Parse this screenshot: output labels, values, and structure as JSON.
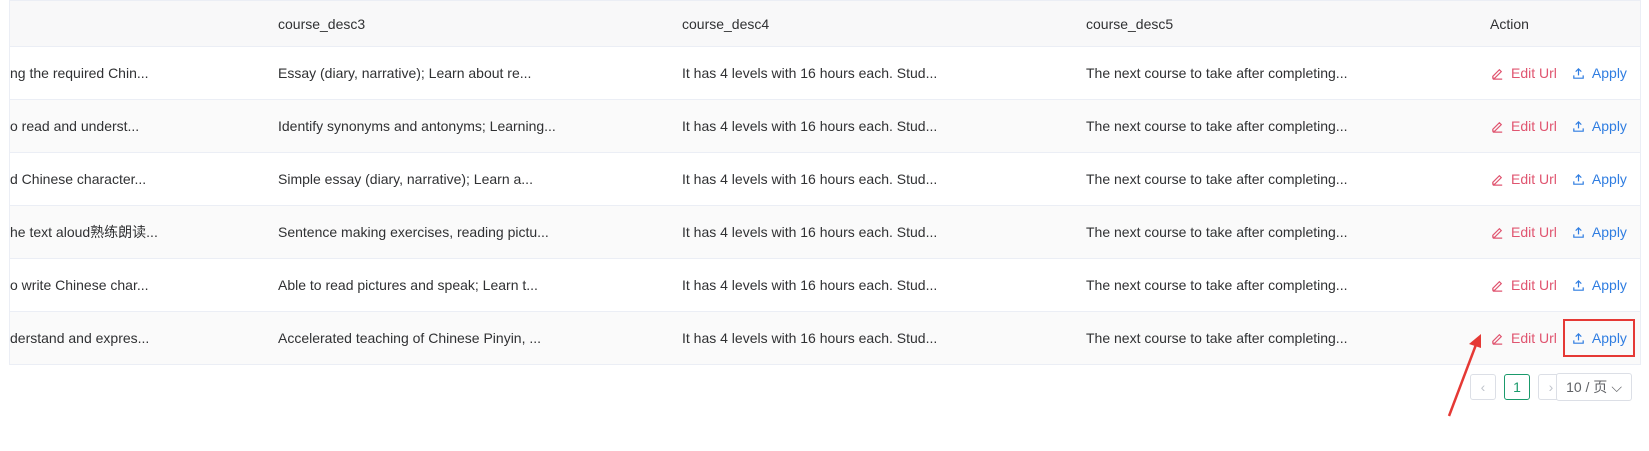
{
  "columns": {
    "desc3": "course_desc3",
    "desc4": "course_desc4",
    "desc5": "course_desc5",
    "action": "Action"
  },
  "rows": [
    {
      "c2": "ng the required Chin...",
      "c3": "Essay (diary, narrative); Learn about re...",
      "c4": "It has 4 levels with 16 hours each. Stud...",
      "c5": "The next course to take after completing..."
    },
    {
      "c2": "o read and underst...",
      "c3": "Identify synonyms and antonyms; Learning...",
      "c4": "It has 4 levels with 16 hours each. Stud...",
      "c5": "The next course to take after completing..."
    },
    {
      "c2": "d Chinese character...",
      "c3": "Simple essay (diary, narrative); Learn a...",
      "c4": "It has 4 levels with 16 hours each. Stud...",
      "c5": "The next course to take after completing..."
    },
    {
      "c2": "he text aloud熟练朗读...",
      "c3": "Sentence making exercises, reading pictu...",
      "c4": "It has 4 levels with 16 hours each. Stud...",
      "c5": "The next course to take after completing..."
    },
    {
      "c2": "o write Chinese char...",
      "c3": "Able to read pictures and speak; Learn t...",
      "c4": "It has 4 levels with 16 hours each. Stud...",
      "c5": "The next course to take after completing..."
    },
    {
      "c2": "derstand and expres...",
      "c3": "Accelerated teaching of Chinese Pinyin, ...",
      "c4": "It has 4 levels with 16 hours each. Stud...",
      "c5": "The next course to take after completing..."
    }
  ],
  "actions": {
    "edit": "Edit Url",
    "apply": "Apply"
  },
  "pagination": {
    "prev": "‹",
    "current": "1",
    "next": "›",
    "page_size": "10 / 页",
    "dropdown": "⌵"
  },
  "colors": {
    "edit": "#e05570",
    "apply": "#2f7de1",
    "highlight": "#e53935",
    "pager_active": "#1a9a6b"
  }
}
